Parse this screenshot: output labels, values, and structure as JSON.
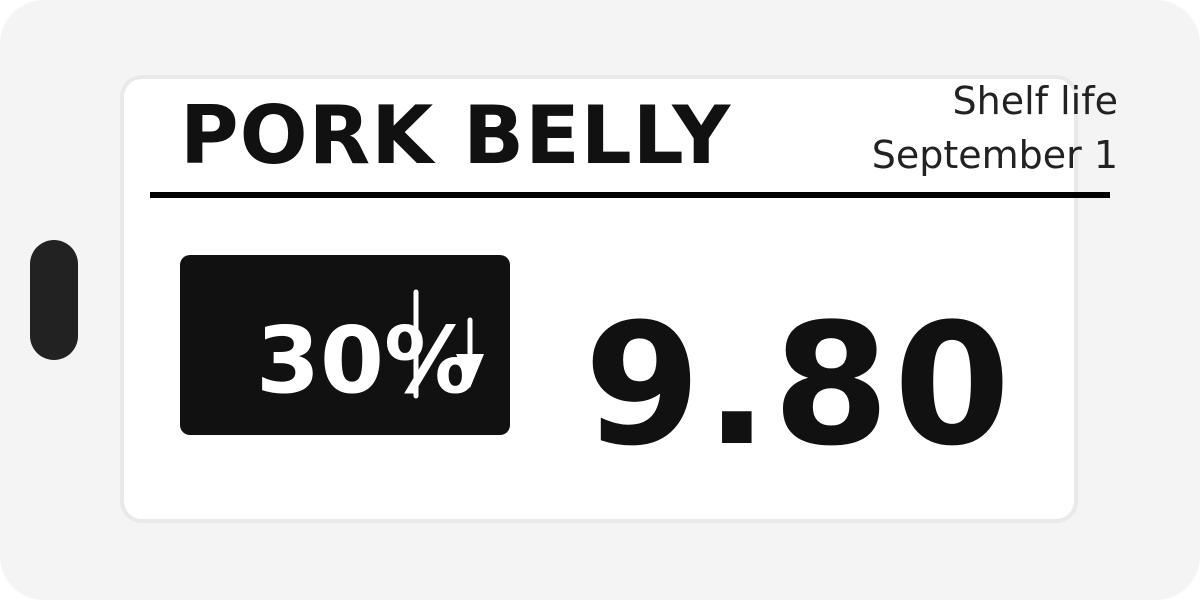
{
  "tag": {
    "product_name": "PORK BELLY",
    "shelf_life_label": "Shelf life",
    "shelf_life_date": "September 1",
    "discount": "30%",
    "discount_icon": "down-arrow-icon",
    "price": "9.80"
  },
  "colors": {
    "body": "#f4f4f4",
    "screen": "#ffffff",
    "ink": "#111111",
    "badge": "#111111",
    "badge_text": "#ffffff"
  }
}
